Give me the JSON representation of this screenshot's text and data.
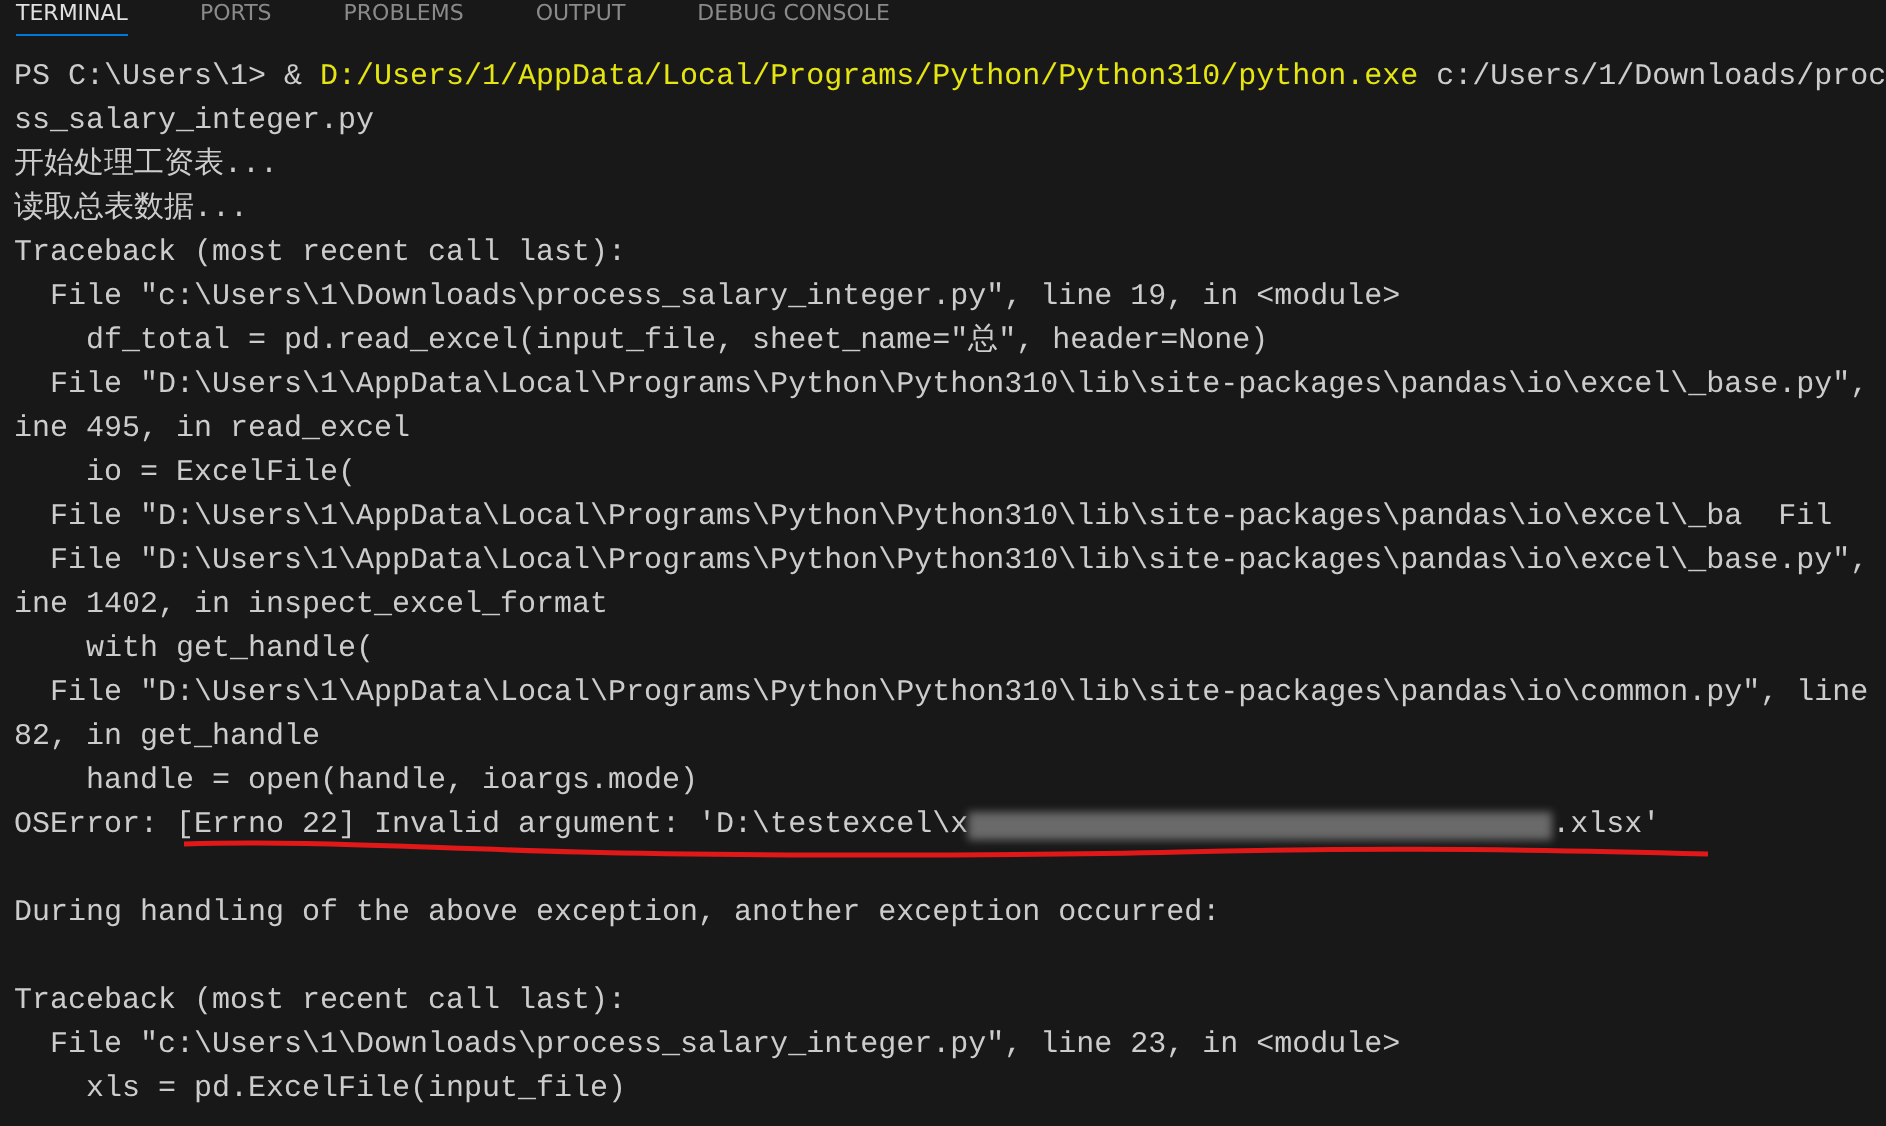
{
  "panel_tabs": [
    {
      "label": "TERMINAL",
      "selected": true
    },
    {
      "label": "PORTS",
      "selected": false
    },
    {
      "label": "PROBLEMS",
      "selected": false
    },
    {
      "label": "OUTPUT",
      "selected": false
    },
    {
      "label": "DEBUG CONSOLE",
      "selected": false
    }
  ],
  "terminal_lines": [
    {
      "kind": "command",
      "prompt": "PS C:\\Users\\1> & ",
      "executable": "D:/Users/1/AppData/Local/Programs/Python/Python310/python.exe",
      "args": " c:/Users/1/Downloads/proc"
    },
    {
      "kind": "text",
      "text": "ss_salary_integer.py"
    },
    {
      "kind": "text",
      "text": "开始处理工资表..."
    },
    {
      "kind": "text",
      "text": "读取总表数据..."
    },
    {
      "kind": "text",
      "text": "Traceback (most recent call last):"
    },
    {
      "kind": "text",
      "text": "  File \"c:\\Users\\1\\Downloads\\process_salary_integer.py\", line 19, in <module>"
    },
    {
      "kind": "text",
      "text": "    df_total = pd.read_excel(input_file, sheet_name=\"总\", header=None)"
    },
    {
      "kind": "text",
      "text": "  File \"D:\\Users\\1\\AppData\\Local\\Programs\\Python\\Python310\\lib\\site-packages\\pandas\\io\\excel\\_base.py\","
    },
    {
      "kind": "text",
      "text": "ine 495, in read_excel"
    },
    {
      "kind": "text",
      "text": "    io = ExcelFile("
    },
    {
      "kind": "text",
      "text": "  File \"D:\\Users\\1\\AppData\\Local\\Programs\\Python\\Python310\\lib\\site-packages\\pandas\\io\\excel\\_ba  Fil"
    },
    {
      "kind": "text",
      "text": "  File \"D:\\Users\\1\\AppData\\Local\\Programs\\Python\\Python310\\lib\\site-packages\\pandas\\io\\excel\\_base.py\","
    },
    {
      "kind": "text",
      "text": "ine 1402, in inspect_excel_format"
    },
    {
      "kind": "text",
      "text": "    with get_handle("
    },
    {
      "kind": "text",
      "text": "  File \"D:\\Users\\1\\AppData\\Local\\Programs\\Python\\Python310\\lib\\site-packages\\pandas\\io\\common.py\", line"
    },
    {
      "kind": "text",
      "text": "82, in get_handle"
    },
    {
      "kind": "text",
      "text": "    handle = open(handle, ioargs.mode)"
    },
    {
      "kind": "error",
      "before": "OSError: [Errno 22] Invalid argument: 'D:\\testexcel\\x",
      "after": ".xlsx'",
      "underlined": true
    },
    {
      "kind": "blank"
    },
    {
      "kind": "text",
      "text": "During handling of the above exception, another exception occurred:"
    },
    {
      "kind": "blank"
    },
    {
      "kind": "text",
      "text": "Traceback (most recent call last):"
    },
    {
      "kind": "text",
      "text": "  File \"c:\\Users\\1\\Downloads\\process_salary_integer.py\", line 23, in <module>"
    },
    {
      "kind": "text",
      "text": "    xls = pd.ExcelFile(input_file)"
    }
  ]
}
